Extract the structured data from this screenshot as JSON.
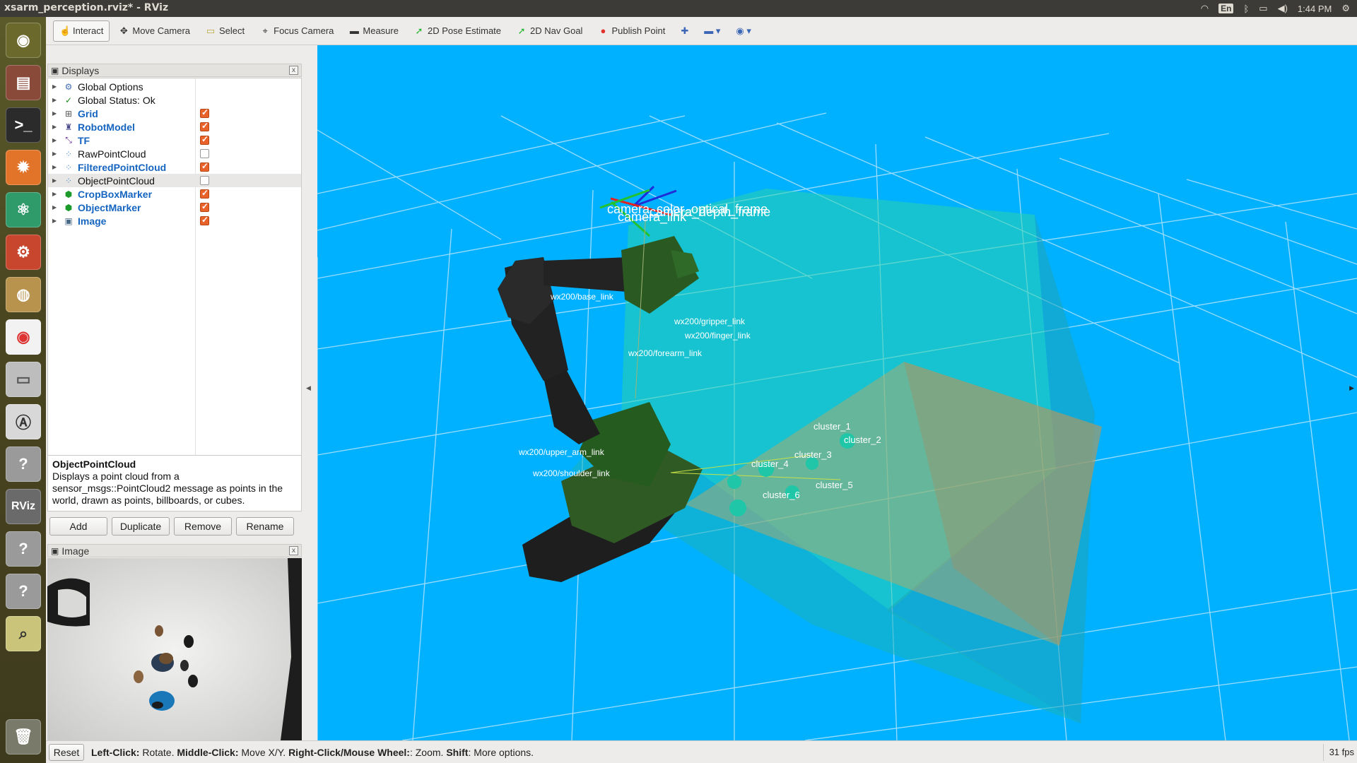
{
  "window": {
    "title": "xsarm_perception.rviz* - RViz"
  },
  "tray": {
    "lang": "En",
    "time": "1:44 PM"
  },
  "toolbar": {
    "tools": [
      {
        "label": "Interact",
        "icon": "hand-icon",
        "active": true
      },
      {
        "label": "Move Camera",
        "icon": "move-camera-icon"
      },
      {
        "label": "Select",
        "icon": "select-icon"
      },
      {
        "label": "Focus Camera",
        "icon": "focus-camera-icon"
      },
      {
        "label": "Measure",
        "icon": "measure-icon"
      },
      {
        "label": "2D Pose Estimate",
        "icon": "pose-arrow-icon"
      },
      {
        "label": "2D Nav Goal",
        "icon": "nav-arrow-icon"
      },
      {
        "label": "Publish Point",
        "icon": "pin-icon"
      }
    ]
  },
  "displays": {
    "title": "Displays",
    "items": [
      {
        "label": "Global Options",
        "icon": "gear-icon",
        "bold": false,
        "checked": null
      },
      {
        "label": "Global Status: Ok",
        "icon": "check-icon",
        "bold": false,
        "checked": null
      },
      {
        "label": "Grid",
        "icon": "grid-icon",
        "bold": true,
        "checked": true
      },
      {
        "label": "RobotModel",
        "icon": "robot-icon",
        "bold": true,
        "checked": true
      },
      {
        "label": "TF",
        "icon": "axes-icon",
        "bold": true,
        "checked": true
      },
      {
        "label": "RawPointCloud",
        "icon": "points-icon",
        "bold": false,
        "checked": false
      },
      {
        "label": "FilteredPointCloud",
        "icon": "points-icon",
        "bold": true,
        "checked": true
      },
      {
        "label": "ObjectPointCloud",
        "icon": "points-icon",
        "bold": false,
        "checked": false,
        "selected": true
      },
      {
        "label": "CropBoxMarker",
        "icon": "marker-icon",
        "bold": true,
        "checked": true
      },
      {
        "label": "ObjectMarker",
        "icon": "marker-icon",
        "bold": true,
        "checked": true
      },
      {
        "label": "Image",
        "icon": "image-icon",
        "bold": true,
        "checked": true
      }
    ]
  },
  "description": {
    "title": "ObjectPointCloud",
    "text": "Displays a point cloud from a sensor_msgs::PointCloud2 message as points in the world, drawn as points, billboards, or cubes."
  },
  "buttons": {
    "add": "Add",
    "duplicate": "Duplicate",
    "remove": "Remove",
    "rename": "Rename"
  },
  "image_panel": {
    "title": "Image"
  },
  "scene": {
    "frame_labels": [
      "camera_color_optical_frame",
      "camera_link",
      "camera_depth_frame"
    ],
    "link_labels": [
      "wx200/upper_arm_link",
      "wx200/shoulder_link",
      "wx200/gripper_link",
      "wx200/finger_link",
      "wx200/forearm_link",
      "wx200/base_link"
    ],
    "clusters": [
      "cluster_1",
      "cluster_2",
      "cluster_3",
      "cluster_4",
      "cluster_5",
      "cluster_6"
    ]
  },
  "status": {
    "reset": "Reset",
    "hint_parts": [
      {
        "b": "Left-Click:",
        "t": " Rotate. "
      },
      {
        "b": "Middle-Click:",
        "t": " Move X/Y. "
      },
      {
        "b": "Right-Click/Mouse Wheel:",
        "t": ": Zoom. "
      },
      {
        "b": "Shift",
        "t": ": More options."
      }
    ],
    "fps": "31 fps"
  }
}
